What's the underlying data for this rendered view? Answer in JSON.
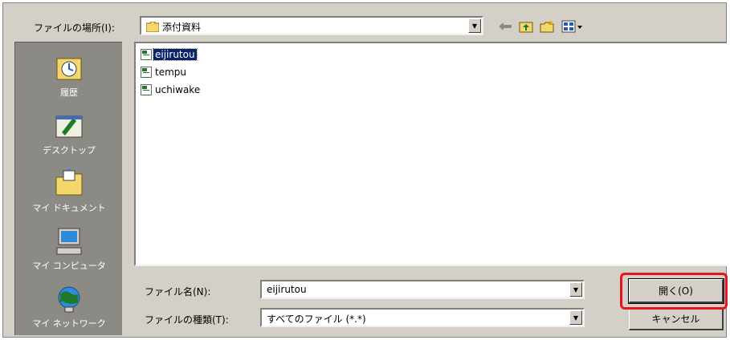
{
  "toolbar": {
    "look_in_label": "ファイルの場所(I):",
    "look_in_value": "添付資料",
    "back_icon": "back-arrow-icon",
    "up_icon": "up-folder-icon",
    "new_folder_icon": "new-folder-icon",
    "view_icon": "view-menu-icon"
  },
  "places": [
    {
      "label": "履歴",
      "icon": "history-icon"
    },
    {
      "label": "デスクトップ",
      "icon": "desktop-icon"
    },
    {
      "label": "マイ ドキュメント",
      "icon": "my-documents-icon"
    },
    {
      "label": "マイ コンピュータ",
      "icon": "my-computer-icon"
    },
    {
      "label": "マイ ネットワーク",
      "icon": "my-network-icon"
    }
  ],
  "files": [
    {
      "name": "eijirutou",
      "selected": true
    },
    {
      "name": "tempu",
      "selected": false
    },
    {
      "name": "uchiwake",
      "selected": false
    }
  ],
  "filename": {
    "label": "ファイル名(N):",
    "value": "eijirutou"
  },
  "filetype": {
    "label": "ファイルの種類(T):",
    "value": "すべてのファイル (*.*)"
  },
  "buttons": {
    "open": "開く(O)",
    "cancel": "キャンセル"
  },
  "colors": {
    "highlight_box": "#e8141b",
    "selection": "#0a246a",
    "dialog_bg": "#d4d0c8",
    "places_bg": "#8c8a84"
  }
}
